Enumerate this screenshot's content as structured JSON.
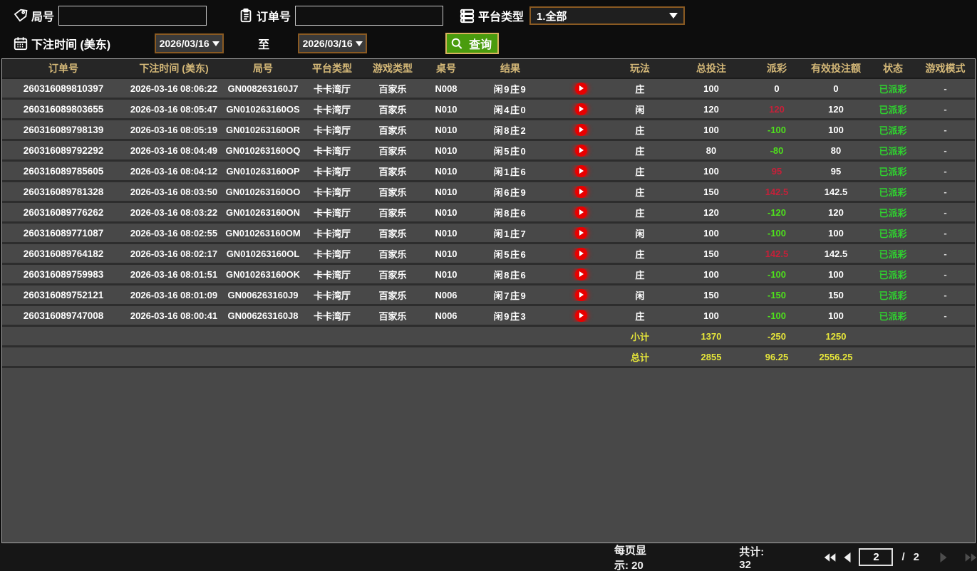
{
  "palette": {
    "gold_header": "#d4b878",
    "row_bg": "#484848",
    "win_red": "#c62039",
    "loss_green": "#4ee01c",
    "status_green": "#2fd32f",
    "total_yellow": "#e8e83a",
    "accent_border": "#8a5a22",
    "button_green": "#4a9c0e"
  },
  "filters": {
    "round_label": "局号",
    "round_value": "",
    "order_label": "订单号",
    "order_value": "",
    "platform_label": "平台类型",
    "platform_selected": "1.全部",
    "bet_time_label": "下注时间 (美东)",
    "date_from": "2026/03/16",
    "to_label": "至",
    "date_to": "2026/03/16",
    "search_label": "查询"
  },
  "table": {
    "headers": [
      "订单号",
      "下注时间 (美东)",
      "局号",
      "平台类型",
      "游戏类型",
      "桌号",
      "结果",
      "",
      "玩法",
      "总投注",
      "派彩",
      "有效投注额",
      "状态",
      "游戏模式"
    ],
    "rows": [
      {
        "order_no": "260316089810397",
        "bet_time": "2026-03-16 08:06:22",
        "round_no": "GN008263160J7",
        "platform": "卡卡湾厅",
        "game_type": "百家乐",
        "table_no": "N008",
        "result": "闲9庄9",
        "play": "庄",
        "total_bet": "100",
        "payout": "0",
        "valid_bet": "0",
        "status": "已派彩",
        "game_mode": "-"
      },
      {
        "order_no": "260316089803655",
        "bet_time": "2026-03-16 08:05:47",
        "round_no": "GN010263160OS",
        "platform": "卡卡湾厅",
        "game_type": "百家乐",
        "table_no": "N010",
        "result": "闲4庄0",
        "play": "闲",
        "total_bet": "120",
        "payout": "120",
        "valid_bet": "120",
        "status": "已派彩",
        "game_mode": "-"
      },
      {
        "order_no": "260316089798139",
        "bet_time": "2026-03-16 08:05:19",
        "round_no": "GN010263160OR",
        "platform": "卡卡湾厅",
        "game_type": "百家乐",
        "table_no": "N010",
        "result": "闲8庄2",
        "play": "庄",
        "total_bet": "100",
        "payout": "-100",
        "valid_bet": "100",
        "status": "已派彩",
        "game_mode": "-"
      },
      {
        "order_no": "260316089792292",
        "bet_time": "2026-03-16 08:04:49",
        "round_no": "GN010263160OQ",
        "platform": "卡卡湾厅",
        "game_type": "百家乐",
        "table_no": "N010",
        "result": "闲5庄0",
        "play": "庄",
        "total_bet": "80",
        "payout": "-80",
        "valid_bet": "80",
        "status": "已派彩",
        "game_mode": "-"
      },
      {
        "order_no": "260316089785605",
        "bet_time": "2026-03-16 08:04:12",
        "round_no": "GN010263160OP",
        "platform": "卡卡湾厅",
        "game_type": "百家乐",
        "table_no": "N010",
        "result": "闲1庄6",
        "play": "庄",
        "total_bet": "100",
        "payout": "95",
        "valid_bet": "95",
        "status": "已派彩",
        "game_mode": "-"
      },
      {
        "order_no": "260316089781328",
        "bet_time": "2026-03-16 08:03:50",
        "round_no": "GN010263160OO",
        "platform": "卡卡湾厅",
        "game_type": "百家乐",
        "table_no": "N010",
        "result": "闲6庄9",
        "play": "庄",
        "total_bet": "150",
        "payout": "142.5",
        "valid_bet": "142.5",
        "status": "已派彩",
        "game_mode": "-"
      },
      {
        "order_no": "260316089776262",
        "bet_time": "2026-03-16 08:03:22",
        "round_no": "GN010263160ON",
        "platform": "卡卡湾厅",
        "game_type": "百家乐",
        "table_no": "N010",
        "result": "闲8庄6",
        "play": "庄",
        "total_bet": "120",
        "payout": "-120",
        "valid_bet": "120",
        "status": "已派彩",
        "game_mode": "-"
      },
      {
        "order_no": "260316089771087",
        "bet_time": "2026-03-16 08:02:55",
        "round_no": "GN010263160OM",
        "platform": "卡卡湾厅",
        "game_type": "百家乐",
        "table_no": "N010",
        "result": "闲1庄7",
        "play": "闲",
        "total_bet": "100",
        "payout": "-100",
        "valid_bet": "100",
        "status": "已派彩",
        "game_mode": "-"
      },
      {
        "order_no": "260316089764182",
        "bet_time": "2026-03-16 08:02:17",
        "round_no": "GN010263160OL",
        "platform": "卡卡湾厅",
        "game_type": "百家乐",
        "table_no": "N010",
        "result": "闲5庄6",
        "play": "庄",
        "total_bet": "150",
        "payout": "142.5",
        "valid_bet": "142.5",
        "status": "已派彩",
        "game_mode": "-"
      },
      {
        "order_no": "260316089759983",
        "bet_time": "2026-03-16 08:01:51",
        "round_no": "GN010263160OK",
        "platform": "卡卡湾厅",
        "game_type": "百家乐",
        "table_no": "N010",
        "result": "闲8庄6",
        "play": "庄",
        "total_bet": "100",
        "payout": "-100",
        "valid_bet": "100",
        "status": "已派彩",
        "game_mode": "-"
      },
      {
        "order_no": "260316089752121",
        "bet_time": "2026-03-16 08:01:09",
        "round_no": "GN006263160J9",
        "platform": "卡卡湾厅",
        "game_type": "百家乐",
        "table_no": "N006",
        "result": "闲7庄9",
        "play": "闲",
        "total_bet": "150",
        "payout": "-150",
        "valid_bet": "150",
        "status": "已派彩",
        "game_mode": "-"
      },
      {
        "order_no": "260316089747008",
        "bet_time": "2026-03-16 08:00:41",
        "round_no": "GN006263160J8",
        "platform": "卡卡湾厅",
        "game_type": "百家乐",
        "table_no": "N006",
        "result": "闲9庄3",
        "play": "庄",
        "total_bet": "100",
        "payout": "-100",
        "valid_bet": "100",
        "status": "已派彩",
        "game_mode": "-"
      }
    ],
    "subtotal": {
      "label": "小计",
      "total_bet": "1370",
      "payout": "-250",
      "valid_bet": "1250"
    },
    "grand_total": {
      "label": "总计",
      "total_bet": "2855",
      "payout": "96.25",
      "valid_bet": "2556.25"
    }
  },
  "pagination": {
    "page_size_label": "每页显示: 20",
    "total_label": "共计: 32",
    "current_page": "2",
    "separator": "/",
    "total_pages": "2"
  }
}
